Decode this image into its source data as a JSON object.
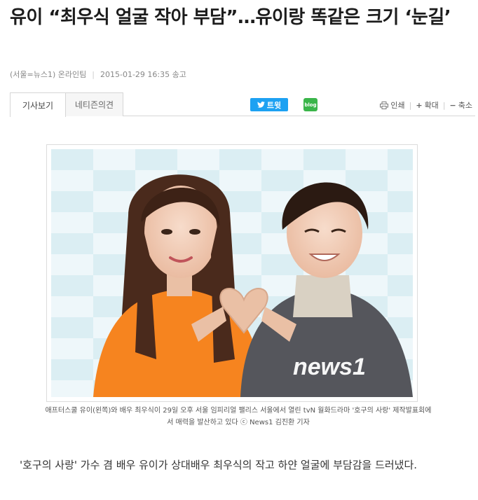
{
  "article": {
    "headline": "유이 “최우식 얼굴 작아 부담”…유이랑 똑같은 크기 ‘눈길’",
    "byline": {
      "source": "(서울=뉴스1) 온라인팀",
      "date": "2015-01-29 16:35 송고"
    },
    "tabs": [
      {
        "label": "기사보기"
      },
      {
        "label": "네티즌의견"
      }
    ],
    "share": {
      "twitter_label": "트윗",
      "blog_label": "blog"
    },
    "tools": {
      "print": "인쇄",
      "zoom_in": "확대",
      "zoom_out": "축소"
    },
    "photo": {
      "watermark": "news1"
    },
    "caption": "애프터스쿨 유이(왼쪽)와 배우 최우식이 29일 오후 서울 임피리얼 팰리스 서울에서 열린 tvN 월화드라마 '호구의 사랑' 제작발표회에서 매력을 발산하고 있다 ⓒ News1 김진환 기자",
    "body": " '호구의 사랑' 가수 겸 배우 유이가 상대배우 최우식의 작고 하얀 얼굴에 부담감을 드러냈다."
  },
  "colors": {
    "twitter": "#1da1f2",
    "blog": "#3ab54a",
    "dress": "#f6841f",
    "jacket": "#55565c"
  },
  "icons": [
    "twitter-bird-icon",
    "blog-icon",
    "printer-icon",
    "plus-icon",
    "minus-icon"
  ]
}
